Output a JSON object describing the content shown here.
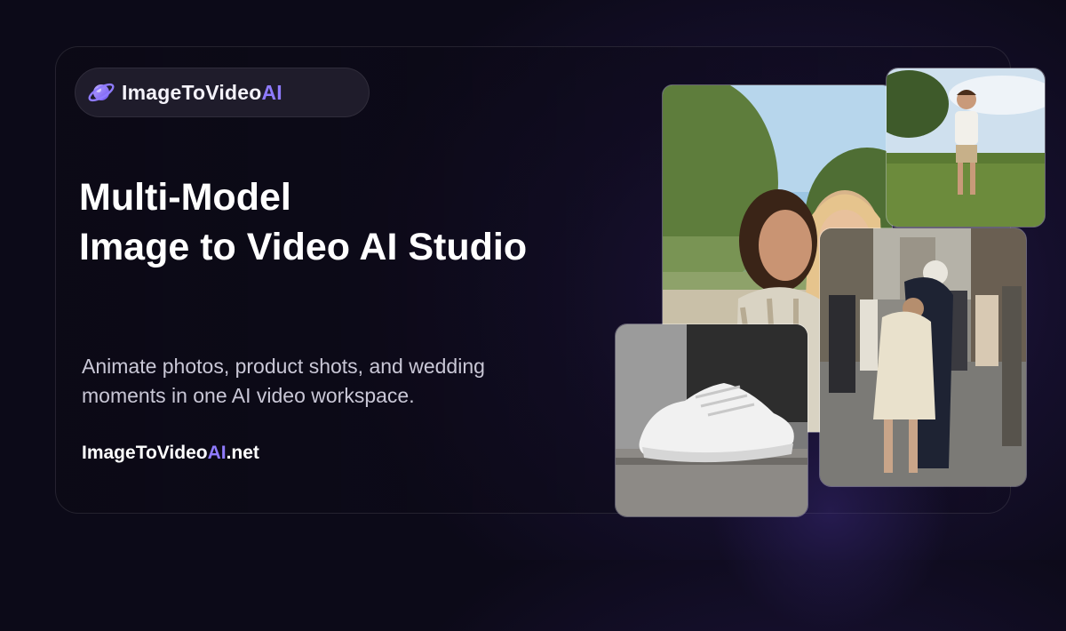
{
  "brand": {
    "name_main": "ImageToVideo",
    "name_accent": "AI",
    "logo_icon": "planet-logo-icon"
  },
  "headline": {
    "line1": "Multi-Model",
    "line2": "Image to Video AI Studio"
  },
  "subtext": {
    "line1": "Animate photos, product shots, and wedding",
    "line2": "moments in one AI video workspace."
  },
  "domain": {
    "main": "ImageToVideo",
    "accent": "AI",
    "suffix": ".net"
  },
  "colors": {
    "accent": "#8f7bff",
    "background": "#120e24",
    "text": "#ffffff",
    "subtext": "#c9c7d6"
  },
  "photos": [
    {
      "subject": "two women laughing outdoors"
    },
    {
      "subject": "boy standing in grass field"
    },
    {
      "subject": "vintage street scene with sailor kissing woman"
    },
    {
      "subject": "white sneaker on concrete ledge"
    }
  ]
}
